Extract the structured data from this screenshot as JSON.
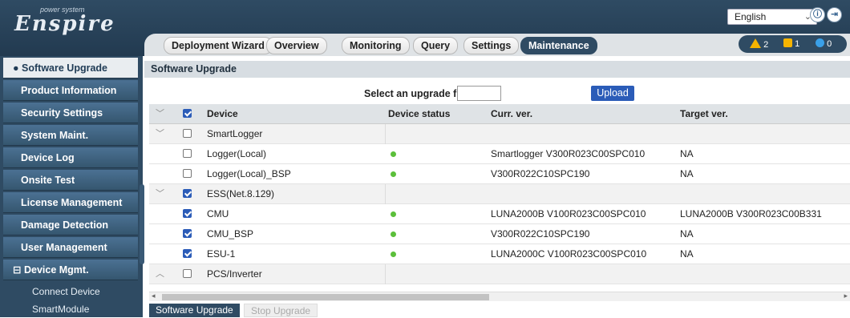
{
  "header": {
    "logo_text": "Enspire",
    "logo_sub": "power system",
    "language": "English",
    "icon_info": "ⓘ",
    "icon_logout": "⇥"
  },
  "tabs": [
    {
      "label": "Deployment Wizard",
      "active": false
    },
    {
      "label": "Overview",
      "active": false
    },
    {
      "label": "Monitoring",
      "active": false
    },
    {
      "label": "Query",
      "active": false
    },
    {
      "label": "Settings",
      "active": false
    },
    {
      "label": "Maintenance",
      "active": true
    }
  ],
  "alarms": {
    "major": "2",
    "minor": "1",
    "warning": "0"
  },
  "sidebar": {
    "items": [
      {
        "label": "Software Upgrade",
        "active": true
      },
      {
        "label": "Product Information"
      },
      {
        "label": "Security Settings"
      },
      {
        "label": "System Maint."
      },
      {
        "label": "Device Log"
      },
      {
        "label": "Onsite Test"
      },
      {
        "label": "License Management"
      },
      {
        "label": "Damage Detection"
      },
      {
        "label": "User Management"
      },
      {
        "label": "Device Mgmt.",
        "expanded": true
      }
    ],
    "subitems": [
      "Connect Device",
      "SmartModule"
    ]
  },
  "main": {
    "title": "Software Upgrade",
    "upload_label": "Select an upgrade file:",
    "upload_button": "Upload",
    "columns": [
      "Device",
      "Device status",
      "Curr. ver.",
      "Target ver."
    ],
    "rows": [
      {
        "type": "group",
        "device": "SmartLogger",
        "checked": false,
        "expanded": true
      },
      {
        "type": "item",
        "device": "Logger(Local)",
        "checked": false,
        "status": "online",
        "curr": "Smartlogger V300R023C00SPC010",
        "target": "NA"
      },
      {
        "type": "item",
        "device": "Logger(Local)_BSP",
        "checked": false,
        "status": "online",
        "curr": "V300R022C10SPC190",
        "target": "NA"
      },
      {
        "type": "group",
        "device": "ESS(Net.8.129)",
        "checked": true,
        "expanded": true
      },
      {
        "type": "item",
        "device": "CMU",
        "checked": true,
        "status": "online",
        "curr": "LUNA2000B V100R023C00SPC010",
        "target": "LUNA2000B V300R023C00B331"
      },
      {
        "type": "item",
        "device": "CMU_BSP",
        "checked": true,
        "status": "online",
        "curr": "V300R022C10SPC190",
        "target": "NA"
      },
      {
        "type": "item",
        "device": "ESU-1",
        "checked": true,
        "status": "online",
        "curr": "LUNA2000C V100R023C00SPC010",
        "target": "NA"
      },
      {
        "type": "group",
        "device": "PCS/Inverter",
        "checked": false,
        "expanded": false
      }
    ],
    "bottom_buttons": {
      "upgrade": "Software Upgrade",
      "stop": "Stop Upgrade"
    }
  },
  "colors": {
    "brand_dark": "#2f4b63",
    "primary": "#2b5cb8",
    "online": "#5bbf3a",
    "alarm": "#f6b400"
  }
}
